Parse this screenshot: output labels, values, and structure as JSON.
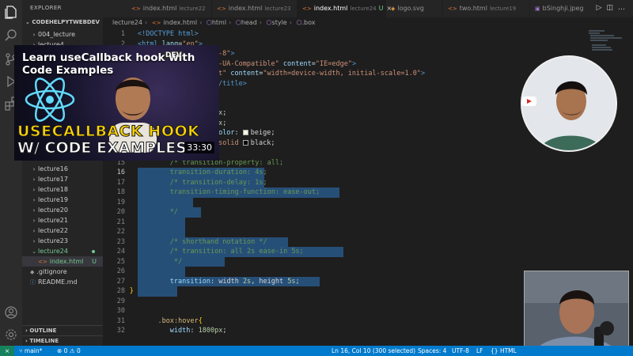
{
  "sidebar": {
    "header": "EXPLORER",
    "more": "···",
    "root": "CODEHELPYTWEBDEV",
    "items": [
      {
        "label": "004_lecture",
        "type": "folder",
        "open": false
      },
      {
        "label": "lecture4",
        "type": "folder",
        "open": false
      },
      {
        "label": "lecture16",
        "type": "folder",
        "open": false
      },
      {
        "label": "lecture17",
        "type": "folder",
        "open": false
      },
      {
        "label": "lecture18",
        "type": "folder",
        "open": false
      },
      {
        "label": "lecture19",
        "type": "folder",
        "open": false
      },
      {
        "label": "lecture20",
        "type": "folder",
        "open": false
      },
      {
        "label": "lecture21",
        "type": "folder",
        "open": false
      },
      {
        "label": "lecture22",
        "type": "folder",
        "open": false
      },
      {
        "label": "lecture23",
        "type": "folder",
        "open": false
      },
      {
        "label": "lecture24",
        "type": "folder",
        "open": true
      },
      {
        "label": "index.html",
        "type": "html",
        "git": "U"
      },
      {
        "label": ".gitignore",
        "type": "git"
      },
      {
        "label": "README.md",
        "type": "md"
      }
    ],
    "outline": "OUTLINE",
    "timeline": "TIMELINE"
  },
  "tabs": [
    {
      "label": "index.html",
      "sub": "lecture22",
      "icon": "html"
    },
    {
      "label": "index.html",
      "sub": "lecture23",
      "icon": "html"
    },
    {
      "label": "index.html",
      "sub": "lecture24",
      "icon": "html",
      "active": true,
      "mod": "U"
    },
    {
      "label": "logo.svg",
      "sub": "",
      "icon": "svg"
    },
    {
      "label": "two.html",
      "sub": "lecture19",
      "icon": "html"
    },
    {
      "label": "bSinghji.jpeg",
      "sub": "",
      "icon": "img"
    }
  ],
  "breadcrumb": [
    "lecture24",
    "index.html",
    "html",
    "head",
    "style",
    ".box"
  ],
  "editor": {
    "lines": [
      {
        "n": "1",
        "parts": [
          [
            "t-tag",
            "<!DOCTYPE html>"
          ]
        ]
      },
      {
        "n": "2",
        "parts": [
          [
            "t-tag",
            "<html "
          ],
          [
            "t-attr",
            "lang"
          ],
          [
            "t-pun",
            "="
          ],
          [
            "t-str",
            "\"en\""
          ],
          [
            "t-tag",
            ">"
          ]
        ]
      },
      {
        "n": "3",
        "parts": [
          [
            "t-str",
            "TF-8\""
          ],
          [
            "t-tag",
            ">"
          ]
        ]
      },
      {
        "n": "4",
        "parts": [
          [
            "t-str",
            "\"X-UA-Compatible\" "
          ],
          [
            "t-attr",
            "content"
          ],
          [
            "t-pun",
            "="
          ],
          [
            "t-str",
            "\"IE=edge\""
          ],
          [
            "t-tag",
            ">"
          ]
        ]
      },
      {
        "n": "5",
        "parts": [
          [
            "t-str",
            "ort\" "
          ],
          [
            "t-attr",
            "content"
          ],
          [
            "t-pun",
            "="
          ],
          [
            "t-str",
            "\"width=device-width, initial-scale=1.0\""
          ],
          [
            "t-tag",
            ">"
          ]
        ]
      },
      {
        "n": "6",
        "parts": [
          [
            "t-pun",
            "n"
          ],
          [
            "t-tag",
            "</title>"
          ]
        ]
      },
      {
        "n": "7",
        "parts": []
      },
      {
        "n": "8",
        "parts": []
      },
      {
        "n": "9",
        "parts": [
          [
            "t-num",
            "400px"
          ],
          [
            "t-pun",
            ";"
          ]
        ]
      },
      {
        "n": "10",
        "parts": [
          [
            "t-num",
            "400px"
          ],
          [
            "t-pun",
            ";"
          ]
        ]
      },
      {
        "n": "11",
        "parts": [
          [
            "t-prop",
            "nd-color"
          ],
          [
            "t-pun",
            ": "
          ],
          [
            "t-swatch",
            "#f5f5dc"
          ],
          [
            "t-pun",
            "beige;"
          ]
        ]
      },
      {
        "n": "12",
        "parts": [
          [
            "t-num",
            "2px"
          ],
          [
            "t-val",
            " solid "
          ],
          [
            "t-swatch",
            "#000000"
          ],
          [
            "t-pun",
            "black;"
          ]
        ]
      },
      {
        "n": "14",
        "parts": []
      },
      {
        "n": "15",
        "parts": [
          [
            "t-com",
            "/* transition-property: all;"
          ]
        ]
      },
      {
        "n": "16",
        "parts": [
          [
            "t-com",
            "transition-duration: 4s;"
          ]
        ]
      },
      {
        "n": "17",
        "parts": [
          [
            "t-com",
            "/* transition-delay: 1s;"
          ]
        ]
      },
      {
        "n": "18",
        "parts": [
          [
            "t-com",
            "transition-timing-function: ease-out;"
          ]
        ]
      },
      {
        "n": "19",
        "parts": []
      },
      {
        "n": "20",
        "parts": [
          [
            "t-com",
            "*/"
          ]
        ]
      },
      {
        "n": "21",
        "parts": []
      },
      {
        "n": "22",
        "parts": []
      },
      {
        "n": "23",
        "parts": [
          [
            "t-com",
            "/* shorthand notation */"
          ]
        ]
      },
      {
        "n": "24",
        "parts": [
          [
            "t-com",
            "/* transition: all 2s ease-in 5s;"
          ]
        ]
      },
      {
        "n": "25",
        "parts": [
          [
            "t-com",
            " */"
          ]
        ]
      },
      {
        "n": "26",
        "parts": []
      },
      {
        "n": "27",
        "parts": [
          [
            "t-prop",
            "transition"
          ],
          [
            "t-pun",
            ": width "
          ],
          [
            "t-num",
            "2s"
          ],
          [
            "t-pun",
            ", height "
          ],
          [
            "t-num",
            "5s"
          ],
          [
            "t-pun",
            ";"
          ]
        ]
      },
      {
        "n": "28",
        "parts": [
          [
            "t-br",
            "}"
          ]
        ]
      },
      {
        "n": "29",
        "parts": []
      },
      {
        "n": "30",
        "parts": []
      },
      {
        "n": "31",
        "parts": [
          [
            "t-sel",
            ".box:hover"
          ],
          [
            "t-br",
            "{"
          ]
        ]
      },
      {
        "n": "32",
        "parts": [
          [
            "t-prop",
            "width"
          ],
          [
            "t-pun",
            ": "
          ],
          [
            "t-num",
            "1800px"
          ],
          [
            "t-pun",
            ";"
          ]
        ]
      }
    ]
  },
  "video": {
    "title": "Learn useCallback hook with Code Examples",
    "headline1": "USECALLBACK HOOK",
    "headline2": "W/ CODE EXAMPLES",
    "badge": "DEV",
    "duration": "33:30"
  },
  "status": {
    "branch": "main*",
    "errors": "0",
    "warnings": "0",
    "position": "Ln 16, Col 10 (300 selected)",
    "spaces": "Spaces: 4",
    "encoding": "UTF-8",
    "eol": "LF",
    "language": "HTML"
  },
  "colors": {
    "accent": "#007acc",
    "selection": "#264f78",
    "git_untracked": "#73c991",
    "thumb_yellow": "#ffd400"
  },
  "icons": [
    "files-icon",
    "search-icon",
    "source-control-icon",
    "run-debug-icon",
    "extensions-icon",
    "account-icon",
    "settings-icon",
    "branch-icon",
    "error-icon",
    "warning-icon"
  ]
}
